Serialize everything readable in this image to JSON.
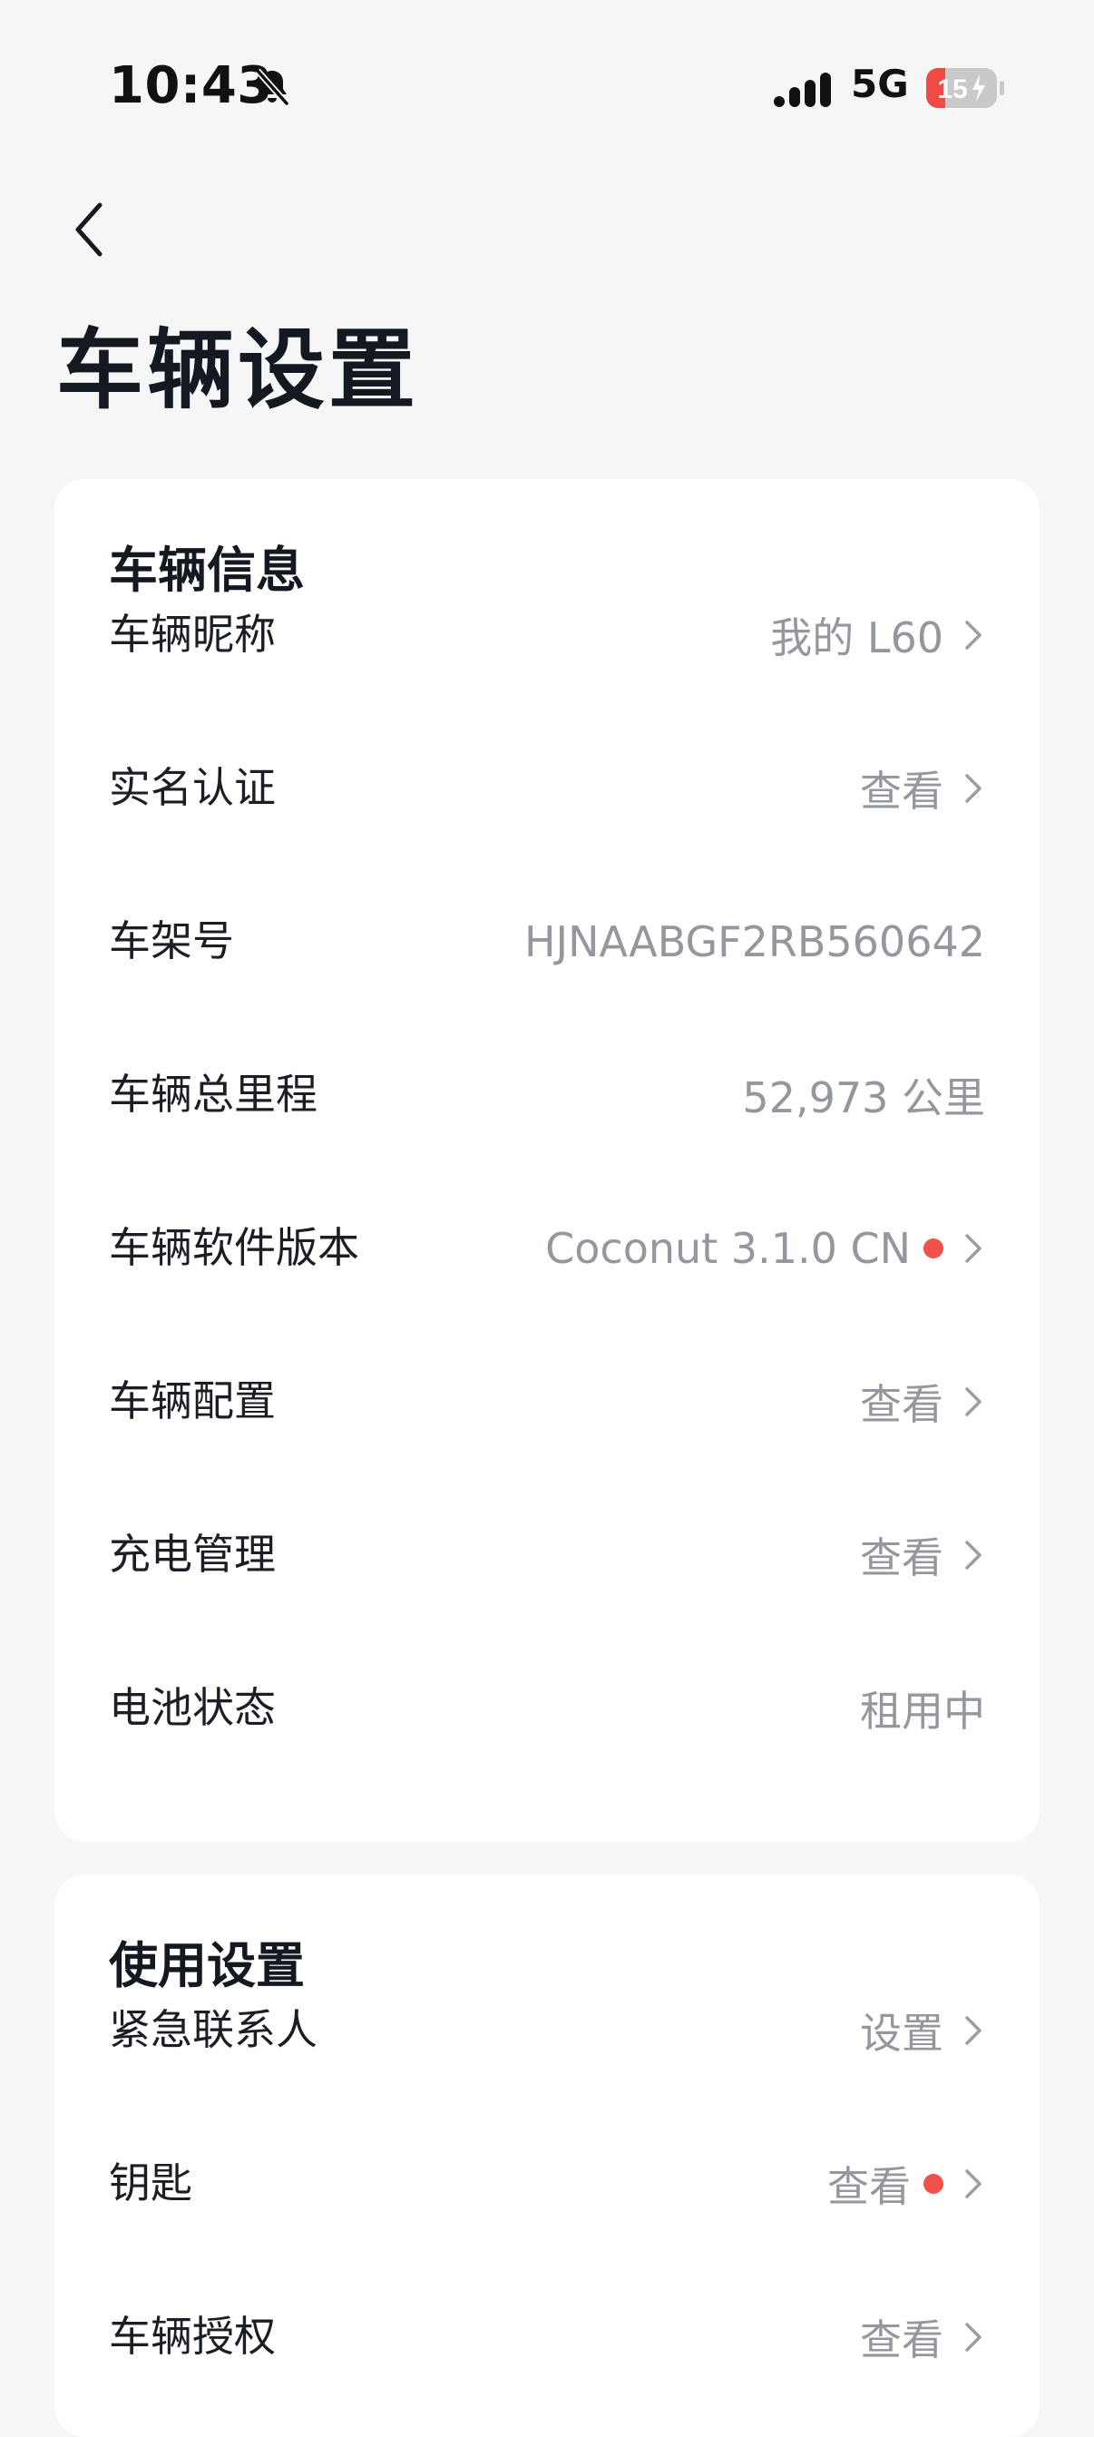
{
  "status_bar": {
    "time": "10:43",
    "network": "5G",
    "battery_level": "15"
  },
  "page": {
    "title": "车辆设置"
  },
  "vehicle_info": {
    "title": "车辆信息",
    "rows": [
      {
        "label": "车辆昵称",
        "value": "我的 L60",
        "chevron": true,
        "dot": false
      },
      {
        "label": "实名认证",
        "value": "查看",
        "chevron": true,
        "dot": false
      },
      {
        "label": "车架号",
        "value": "HJNAABGF2RB560642",
        "chevron": false,
        "dot": false
      },
      {
        "label": "车辆总里程",
        "value": "52,973 公里",
        "chevron": false,
        "dot": false
      },
      {
        "label": "车辆软件版本",
        "value": "Coconut 3.1.0 CN",
        "chevron": true,
        "dot": true
      },
      {
        "label": "车辆配置",
        "value": "查看",
        "chevron": true,
        "dot": false
      },
      {
        "label": "充电管理",
        "value": "查看",
        "chevron": true,
        "dot": false
      },
      {
        "label": "电池状态",
        "value": "租用中",
        "chevron": false,
        "dot": false
      }
    ]
  },
  "usage_settings": {
    "title": "使用设置",
    "rows": [
      {
        "label": "紧急联系人",
        "value": "设置",
        "chevron": true,
        "dot": false
      },
      {
        "label": "钥匙",
        "value": "查看",
        "chevron": true,
        "dot": true
      },
      {
        "label": "车辆授权",
        "value": "查看",
        "chevron": true,
        "dot": false
      }
    ]
  },
  "colors": {
    "background": "#f6f6f6",
    "card": "#ffffff",
    "value_text": "#94979e",
    "badge_dot": "#f0514a",
    "battery_low": "#f04a44"
  }
}
